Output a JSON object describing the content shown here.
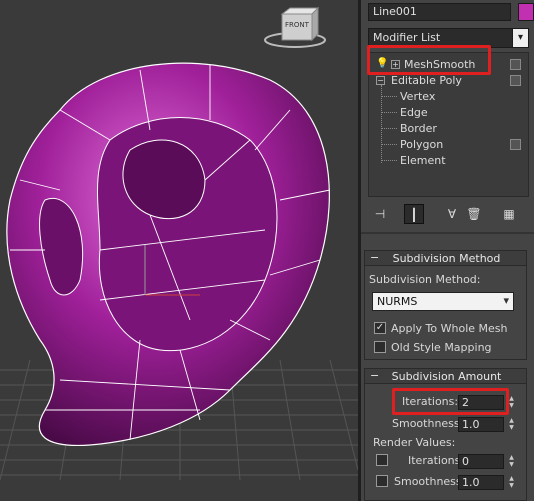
{
  "object_name": "Line001",
  "object_color": "#c030b0",
  "modifier_list": {
    "label": "Modifier List",
    "arrow": "▾"
  },
  "stack": {
    "meshsmooth": "MeshSmooth",
    "editable_poly": "Editable Poly",
    "subobjects": [
      "Vertex",
      "Edge",
      "Border",
      "Polygon",
      "Element"
    ]
  },
  "viewcube_label": "FRONT",
  "subdivision_method": {
    "title": "Subdivision Method",
    "label": "Subdivision Method:",
    "selected": "NURMS",
    "apply_whole_mesh": "Apply To Whole Mesh",
    "old_style_mapping": "Old Style Mapping"
  },
  "subdivision_amount": {
    "title": "Subdivision Amount",
    "iterations_label": "Iterations:",
    "iterations_value": "2",
    "smoothness_label": "Smoothness:",
    "smoothness_value": "1.0",
    "render_values_label": "Render Values:",
    "render_iterations_label": "Iterations:",
    "render_iterations_value": "0",
    "render_smoothness_label": "Smoothness:",
    "render_smoothness_value": "1.0"
  },
  "rollout_minus": "−"
}
